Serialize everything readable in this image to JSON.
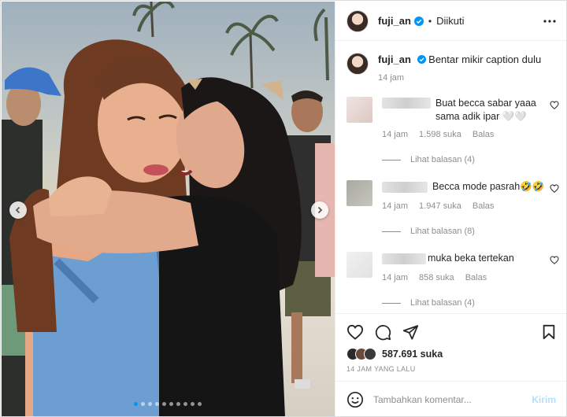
{
  "post": {
    "username": "fuji_an",
    "separator": "•",
    "follow_status": "Diikuti",
    "caption": "Bentar mikir caption dulu",
    "caption_time": "14 jam",
    "likes": "587.691 suka",
    "time_ago": "14 JAM YANG LALU"
  },
  "comments": [
    {
      "text": "Buat becca sabar yaaa sama adik ipar 🤍🤍",
      "time": "14 jam",
      "likes": "1.598 suka",
      "reply_label": "Balas",
      "view_replies": "Lihat balasan (4)",
      "avatar_color": "#e9dcd8"
    },
    {
      "text": "Becca mode pasrah🤣🤣",
      "time": "14 jam",
      "likes": "1.947 suka",
      "reply_label": "Balas",
      "view_replies": "Lihat balasan (8)",
      "avatar_color": "#b5b5ad"
    },
    {
      "text": "muka beka tertekan",
      "time": "14 jam",
      "likes": "858 suka",
      "reply_label": "Balas",
      "view_replies": "Lihat balasan (4)",
      "avatar_color": "#ececec"
    }
  ],
  "input": {
    "placeholder": "Tambahkan komentar...",
    "send_label": "Kirim"
  },
  "icons": {
    "verified": "verified-badge-icon",
    "more": "more-options-icon",
    "heart": "heart-icon",
    "comment": "comment-icon",
    "share": "share-icon",
    "save": "bookmark-icon",
    "emoji": "emoji-icon",
    "prev": "chevron-left-icon",
    "next": "chevron-right-icon"
  },
  "carousel": {
    "slides": 10,
    "active": 0
  },
  "colors": {
    "accent": "#0095f6",
    "text": "#262626",
    "muted": "#8e8e8e",
    "send_disabled": "#b2dffc"
  }
}
